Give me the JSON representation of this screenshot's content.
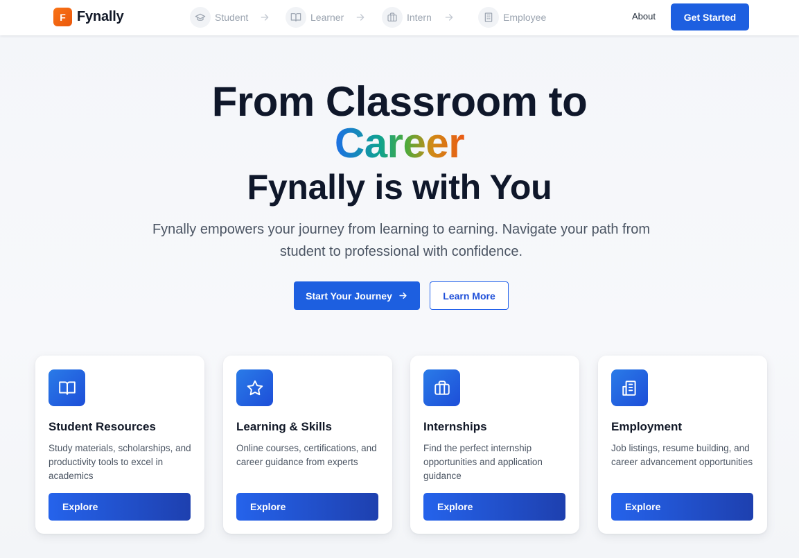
{
  "colors": {
    "primary": "#1d5fe0",
    "logo": "#f97316",
    "heading": "#0f172a"
  },
  "header": {
    "logo_letter": "F",
    "logo_text": "Fynally",
    "steps": [
      {
        "label": "Student",
        "icon": "graduation-cap-icon"
      },
      {
        "label": "Learner",
        "icon": "book-icon"
      },
      {
        "label": "Intern",
        "icon": "briefcase-icon"
      },
      {
        "label": "Employee",
        "icon": "building-icon"
      }
    ],
    "about": "About",
    "get_started": "Get Started"
  },
  "hero": {
    "line1": "From Classroom to",
    "career": "Career",
    "line3": "Fynally is with You",
    "subtitle": "Fynally empowers your journey from learning to earning. Navigate your path from student to professional with confidence.",
    "primary_cta": "Start Your Journey",
    "secondary_cta": "Learn More"
  },
  "cards": [
    {
      "icon": "book-icon",
      "title": "Student Resources",
      "desc": "Study materials, scholarships, and productivity tools to excel in academics",
      "button": "Explore"
    },
    {
      "icon": "star-icon",
      "title": "Learning & Skills",
      "desc": "Online courses, certifications, and career guidance from experts",
      "button": "Explore"
    },
    {
      "icon": "briefcase-icon",
      "title": "Internships",
      "desc": "Find the perfect internship opportunities and application guidance",
      "button": "Explore"
    },
    {
      "icon": "building-icon",
      "title": "Employment",
      "desc": "Job listings, resume building, and career advancement opportunities",
      "button": "Explore"
    }
  ]
}
